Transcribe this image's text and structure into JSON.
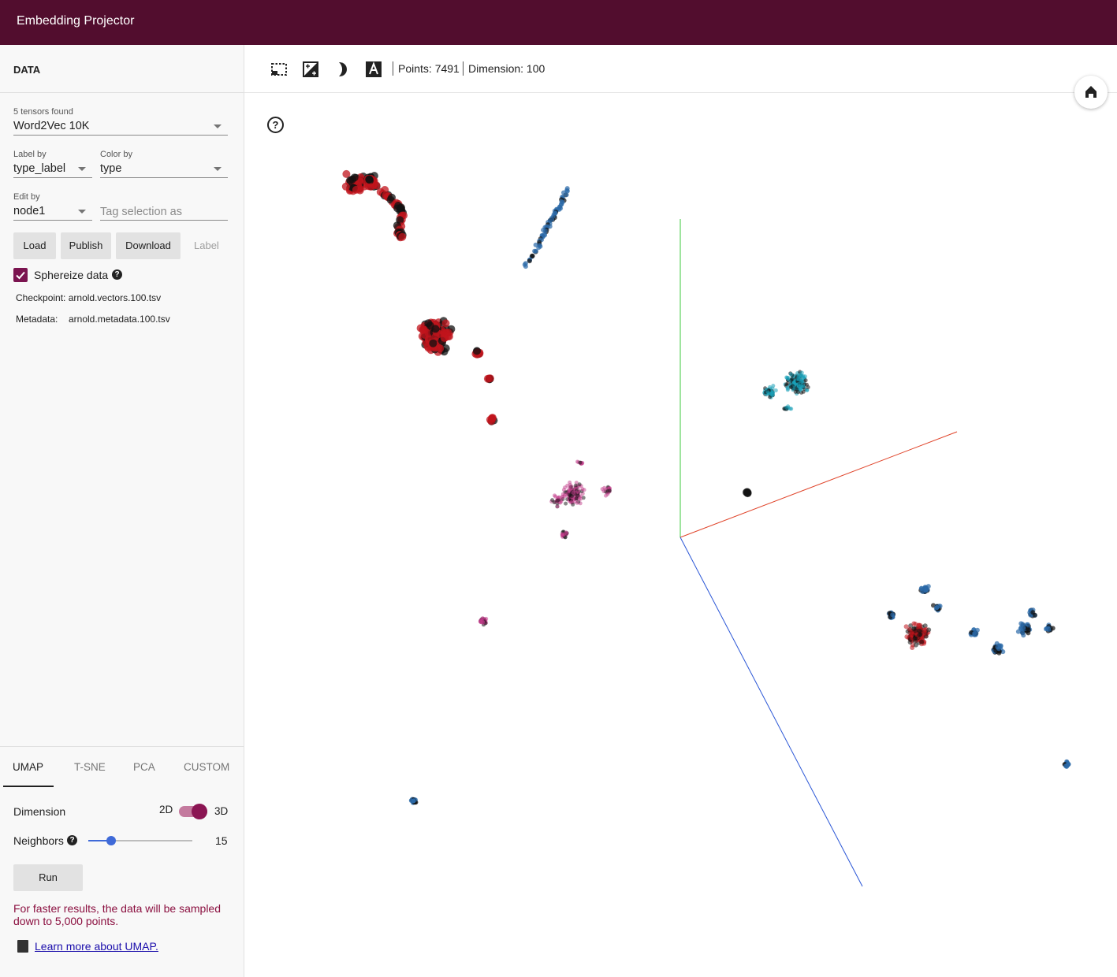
{
  "app": {
    "title": "Embedding Projector"
  },
  "data_panel": {
    "header": "DATA",
    "tensors_label": "5 tensors found",
    "tensor_selected": "Word2Vec 10K",
    "label_by": {
      "label": "Label by",
      "value": "type_label"
    },
    "color_by": {
      "label": "Color by",
      "value": "type"
    },
    "edit_by": {
      "label": "Edit by",
      "value": "node1"
    },
    "tag_placeholder": "Tag selection as",
    "buttons": {
      "load": "Load",
      "publish": "Publish",
      "download": "Download",
      "label": "Label"
    },
    "sphereize": {
      "label": "Sphereize data",
      "checked": true
    },
    "checkpoint": {
      "label": "Checkpoint:",
      "value": "arnold.vectors.100.tsv"
    },
    "metadata": {
      "label": "Metadata:",
      "value": "arnold.metadata.100.tsv"
    }
  },
  "projection_panel": {
    "tabs": [
      "UMAP",
      "T-SNE",
      "PCA",
      "CUSTOM"
    ],
    "active_tab": "UMAP",
    "dimension": {
      "label": "Dimension",
      "option_2d": "2D",
      "option_3d": "3D",
      "selected": "3D"
    },
    "neighbors": {
      "label": "Neighbors",
      "value": "15",
      "min": 5,
      "max": 50
    },
    "run_label": "Run",
    "sample_warning": "For faster results, the data will be sampled down to 5,000 points.",
    "learn_more": "Learn more about UMAP."
  },
  "toolbar": {
    "points": "Points: 7491",
    "dimension": "Dimension: 100",
    "icons": [
      "selection-icon",
      "night-mode-exposure-icon",
      "moon-icon",
      "label-a-icon"
    ]
  },
  "colors": {
    "topbar": "#520d2e",
    "accent": "#7b1450",
    "cluster_red": "#c0141c",
    "cluster_blue": "#2b6aa8",
    "cluster_cyan": "#1aa0b8",
    "cluster_pink": "#c23c8a",
    "axis_x": "#e0442a",
    "axis_y": "#3cc83c",
    "axis_z": "#2a56d6"
  }
}
